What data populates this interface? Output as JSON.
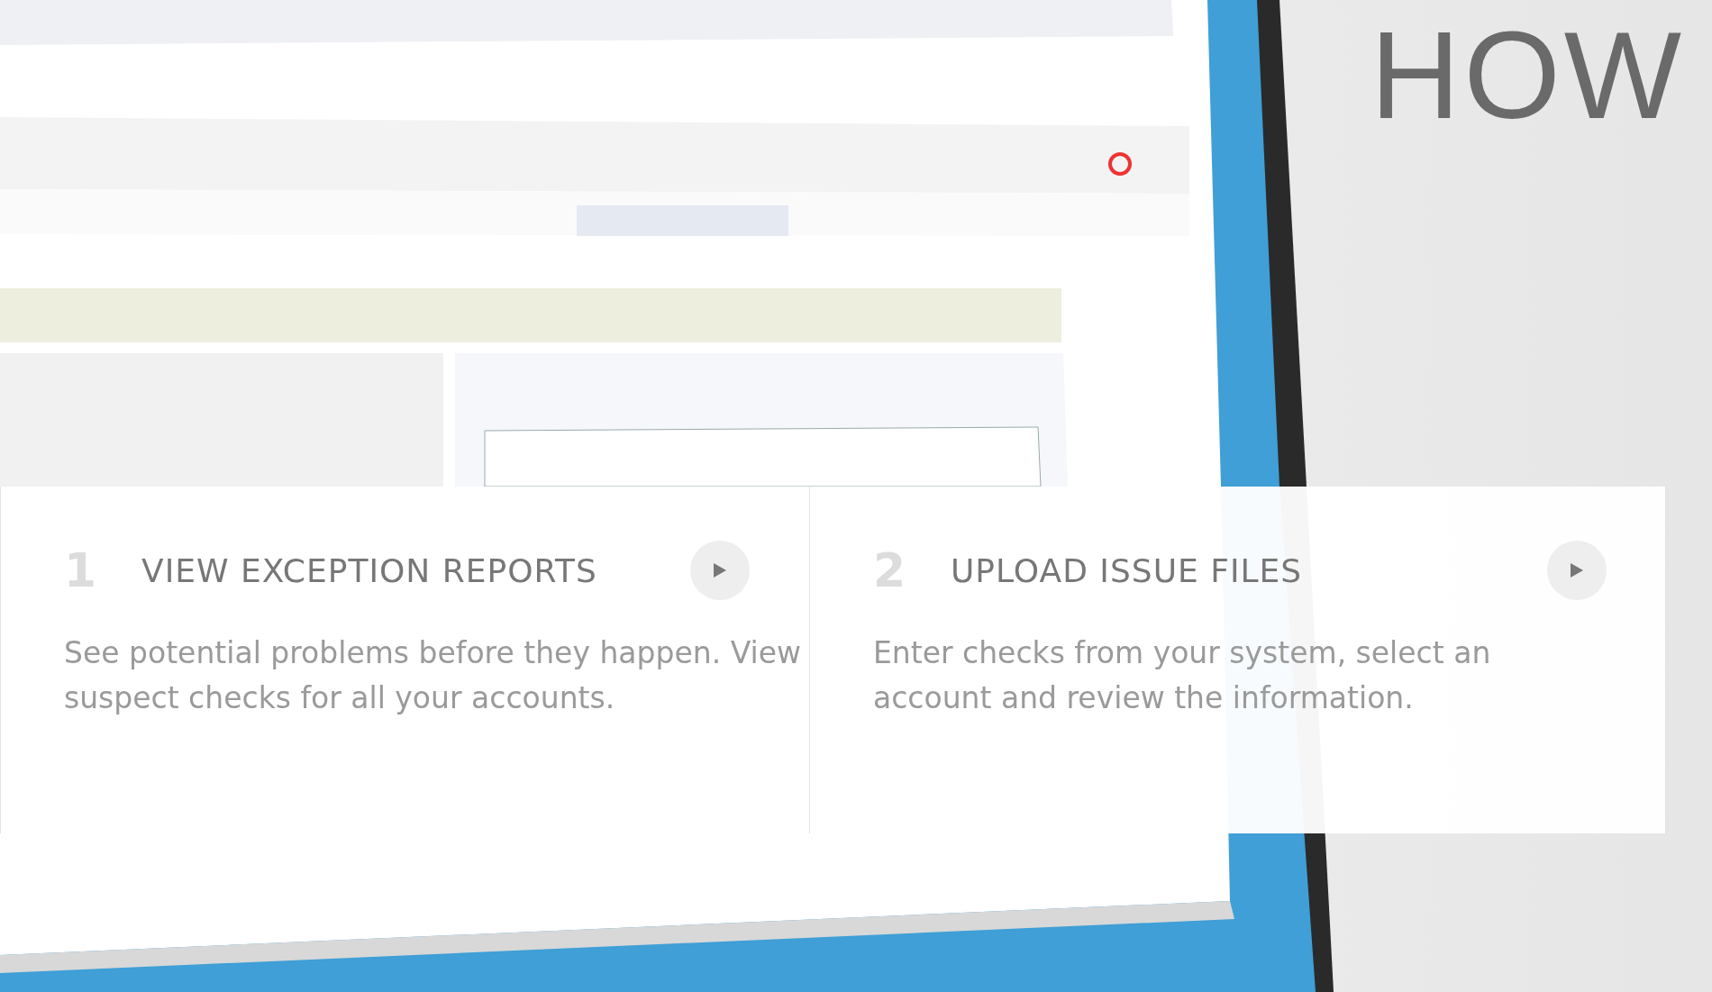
{
  "heading": "HOW",
  "steps": [
    {
      "number": "1",
      "title": "VIEW EXCEPTION REPORTS",
      "description": "See potential problems before they happen.  View suspect checks for all your accounts."
    },
    {
      "number": "2",
      "title": "UPLOAD ISSUE FILES",
      "description": "Enter checks from your system, select an account and review the information."
    }
  ]
}
